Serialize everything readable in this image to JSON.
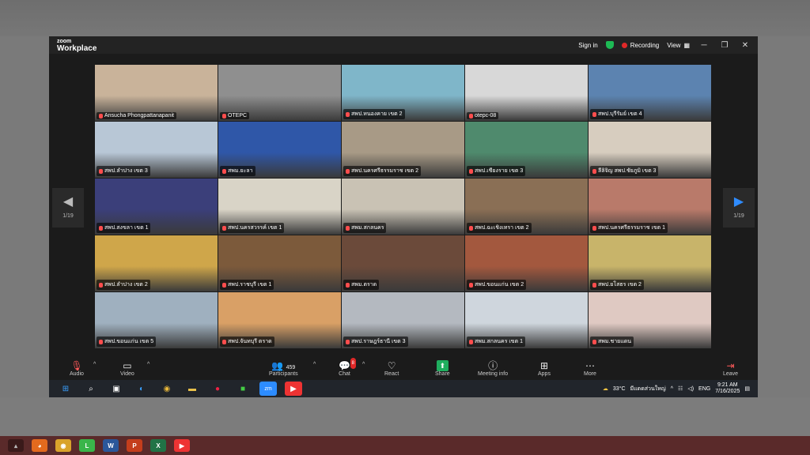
{
  "app": {
    "logo_line1": "zoom",
    "logo_line2": "Workplace"
  },
  "titlebar": {
    "sign_in": "Sign in",
    "recording": "Recording",
    "view": "View"
  },
  "pager": {
    "left": "1/19",
    "right": "1/19"
  },
  "tiles": [
    {
      "label": "Ansucha Phongpattanapanit",
      "bg": "#c9b39a"
    },
    {
      "label": "OTEPC",
      "bg": "#8f8f8f"
    },
    {
      "label": "สพป.หนองคาย เขต 2",
      "bg": "#7fb6c9"
    },
    {
      "label": "otepc-08",
      "bg": "#d8d8d8"
    },
    {
      "label": "สพป.บุรีรัมย์ เขต 4",
      "bg": "#5c83b0"
    },
    {
      "label": "สพป.ลำปาง เขต 3",
      "bg": "#b8c7d6"
    },
    {
      "label": "สพม.ยะลา",
      "bg": "#2f57a8"
    },
    {
      "label": "สพป.นครศรีธรรมราช เขต 2",
      "bg": "#a89a86"
    },
    {
      "label": "สพป.เชียงราย เขต 3",
      "bg": "#4f8a6d"
    },
    {
      "label": "ลีลิจิญ สพป.ชัยภูมิ เขต 3",
      "bg": "#d7cdbf"
    },
    {
      "label": "สพป.สงขลา เขต 1",
      "bg": "#3b3f7a"
    },
    {
      "label": "สพป.นครสวรรค์ เขต 1",
      "bg": "#d9d4c7"
    },
    {
      "label": "สพม.สกลนคร",
      "bg": "#c9c2b4"
    },
    {
      "label": "สพป.ฉะเชิงเทรา เขต 2",
      "bg": "#8a6f55"
    },
    {
      "label": "สพป.นครศรีธรรมราช เขต 1",
      "bg": "#b97a6a"
    },
    {
      "label": "สพป.ลำปาง เขต 2",
      "bg": "#cfa64a"
    },
    {
      "label": "สพป.ราชบุรี เขต 1",
      "bg": "#7c5a3b"
    },
    {
      "label": "สพม.ตราด",
      "bg": "#6b4a3a"
    },
    {
      "label": "สพป.ขอนแก่น เขต 2",
      "bg": "#a3583e"
    },
    {
      "label": "สพป.ยโสธร เขต 2",
      "bg": "#c8b46a"
    },
    {
      "label": "สพป.ขอนแก่น เขต 5",
      "bg": "#9fb0bf"
    },
    {
      "label": "สพป.จันทบุรี ตราด",
      "bg": "#d9a066"
    },
    {
      "label": "สพป.ราษฎร์ธานี เขต 3",
      "bg": "#b4b9c0"
    },
    {
      "label": "สพม.สกลนคร เขต 1",
      "bg": "#cfd6dd"
    },
    {
      "label": "สพม.ชายแดน",
      "bg": "#dfc9c2"
    }
  ],
  "controls": {
    "audio": "Audio",
    "video": "Video",
    "participants": "Participants",
    "participants_count": "459",
    "chat": "Chat",
    "chat_badge": "8",
    "react": "React",
    "share": "Share",
    "meeting_info": "Meeting info",
    "apps": "Apps",
    "more": "More",
    "leave": "Leave"
  },
  "taskbar": {
    "weather": "33°C",
    "weather_desc": "มีแดดส่วนใหญ่",
    "lang": "ENG",
    "time": "9:21 AM",
    "date": "7/16/2025",
    "zoom_icon": "zm"
  },
  "colors": {
    "accent_green": "#1fae5e",
    "record_red": "#e02828",
    "active_outline": "#33cc55",
    "nav_blue": "#2f8cff"
  }
}
